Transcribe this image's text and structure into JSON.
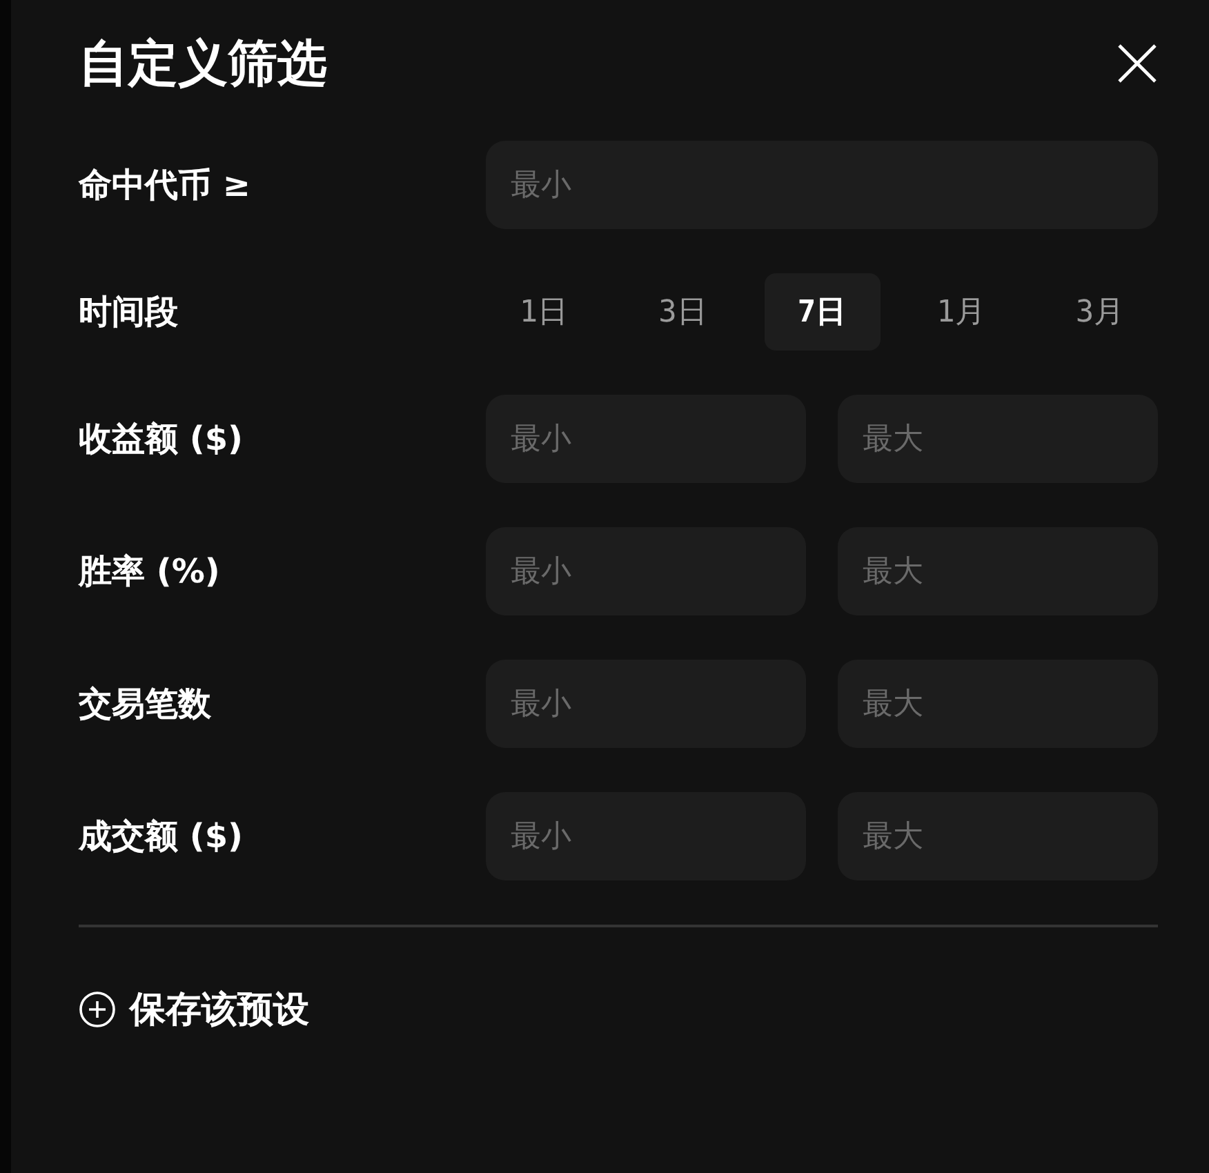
{
  "title": "自定义筛选",
  "filters": [
    {
      "kind": "single",
      "label": "命中代币 ≥",
      "placeholder": "最小"
    },
    {
      "kind": "segments",
      "label": "时间段",
      "options": [
        {
          "label": "1日",
          "selected": false
        },
        {
          "label": "3日",
          "selected": false
        },
        {
          "label": "7日",
          "selected": true
        },
        {
          "label": "1月",
          "selected": false
        },
        {
          "label": "3月",
          "selected": false
        }
      ]
    },
    {
      "kind": "range",
      "label": "收益额 ($)",
      "min_placeholder": "最小",
      "max_placeholder": "最大"
    },
    {
      "kind": "range",
      "label": "胜率 (%)",
      "min_placeholder": "最小",
      "max_placeholder": "最大"
    },
    {
      "kind": "range",
      "label": "交易笔数",
      "min_placeholder": "最小",
      "max_placeholder": "最大"
    },
    {
      "kind": "range",
      "label": "成交额 ($)",
      "min_placeholder": "最小",
      "max_placeholder": "最大"
    }
  ],
  "save_preset": "保存该预设"
}
